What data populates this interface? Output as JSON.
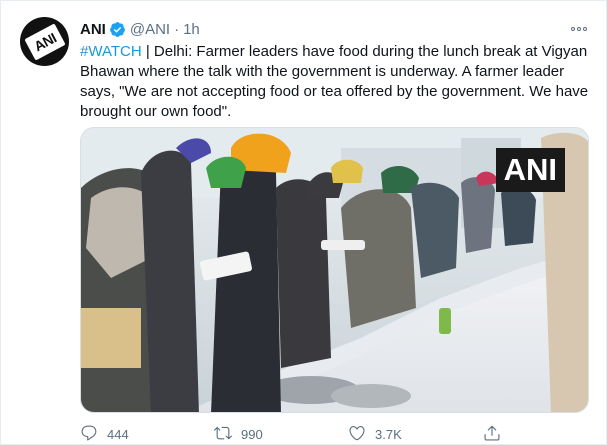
{
  "tweet": {
    "author_name": "ANI",
    "author_handle": "@ANI",
    "separator": "·",
    "time": "1h",
    "avatar_text": "ANI",
    "hashtag": "#WATCH",
    "body": " | Delhi: Farmer leaders have food during the lunch break at Vigyan Bhawan where the talk with the government is underway. A farmer leader says, \"We are not accepting food or tea offered by the government. We have brought our own food\".",
    "media_watermark": "ANI",
    "icons": {
      "verified": "verified-badge-icon",
      "more": "more-options-icon",
      "reply": "reply-icon",
      "retweet": "retweet-icon",
      "like": "heart-icon",
      "share": "share-icon"
    },
    "accent_color": "#1b95e0",
    "verified_color": "#1da1f2",
    "actions": {
      "reply_count": "444",
      "retweet_count": "990",
      "like_count": "3.7K"
    }
  }
}
